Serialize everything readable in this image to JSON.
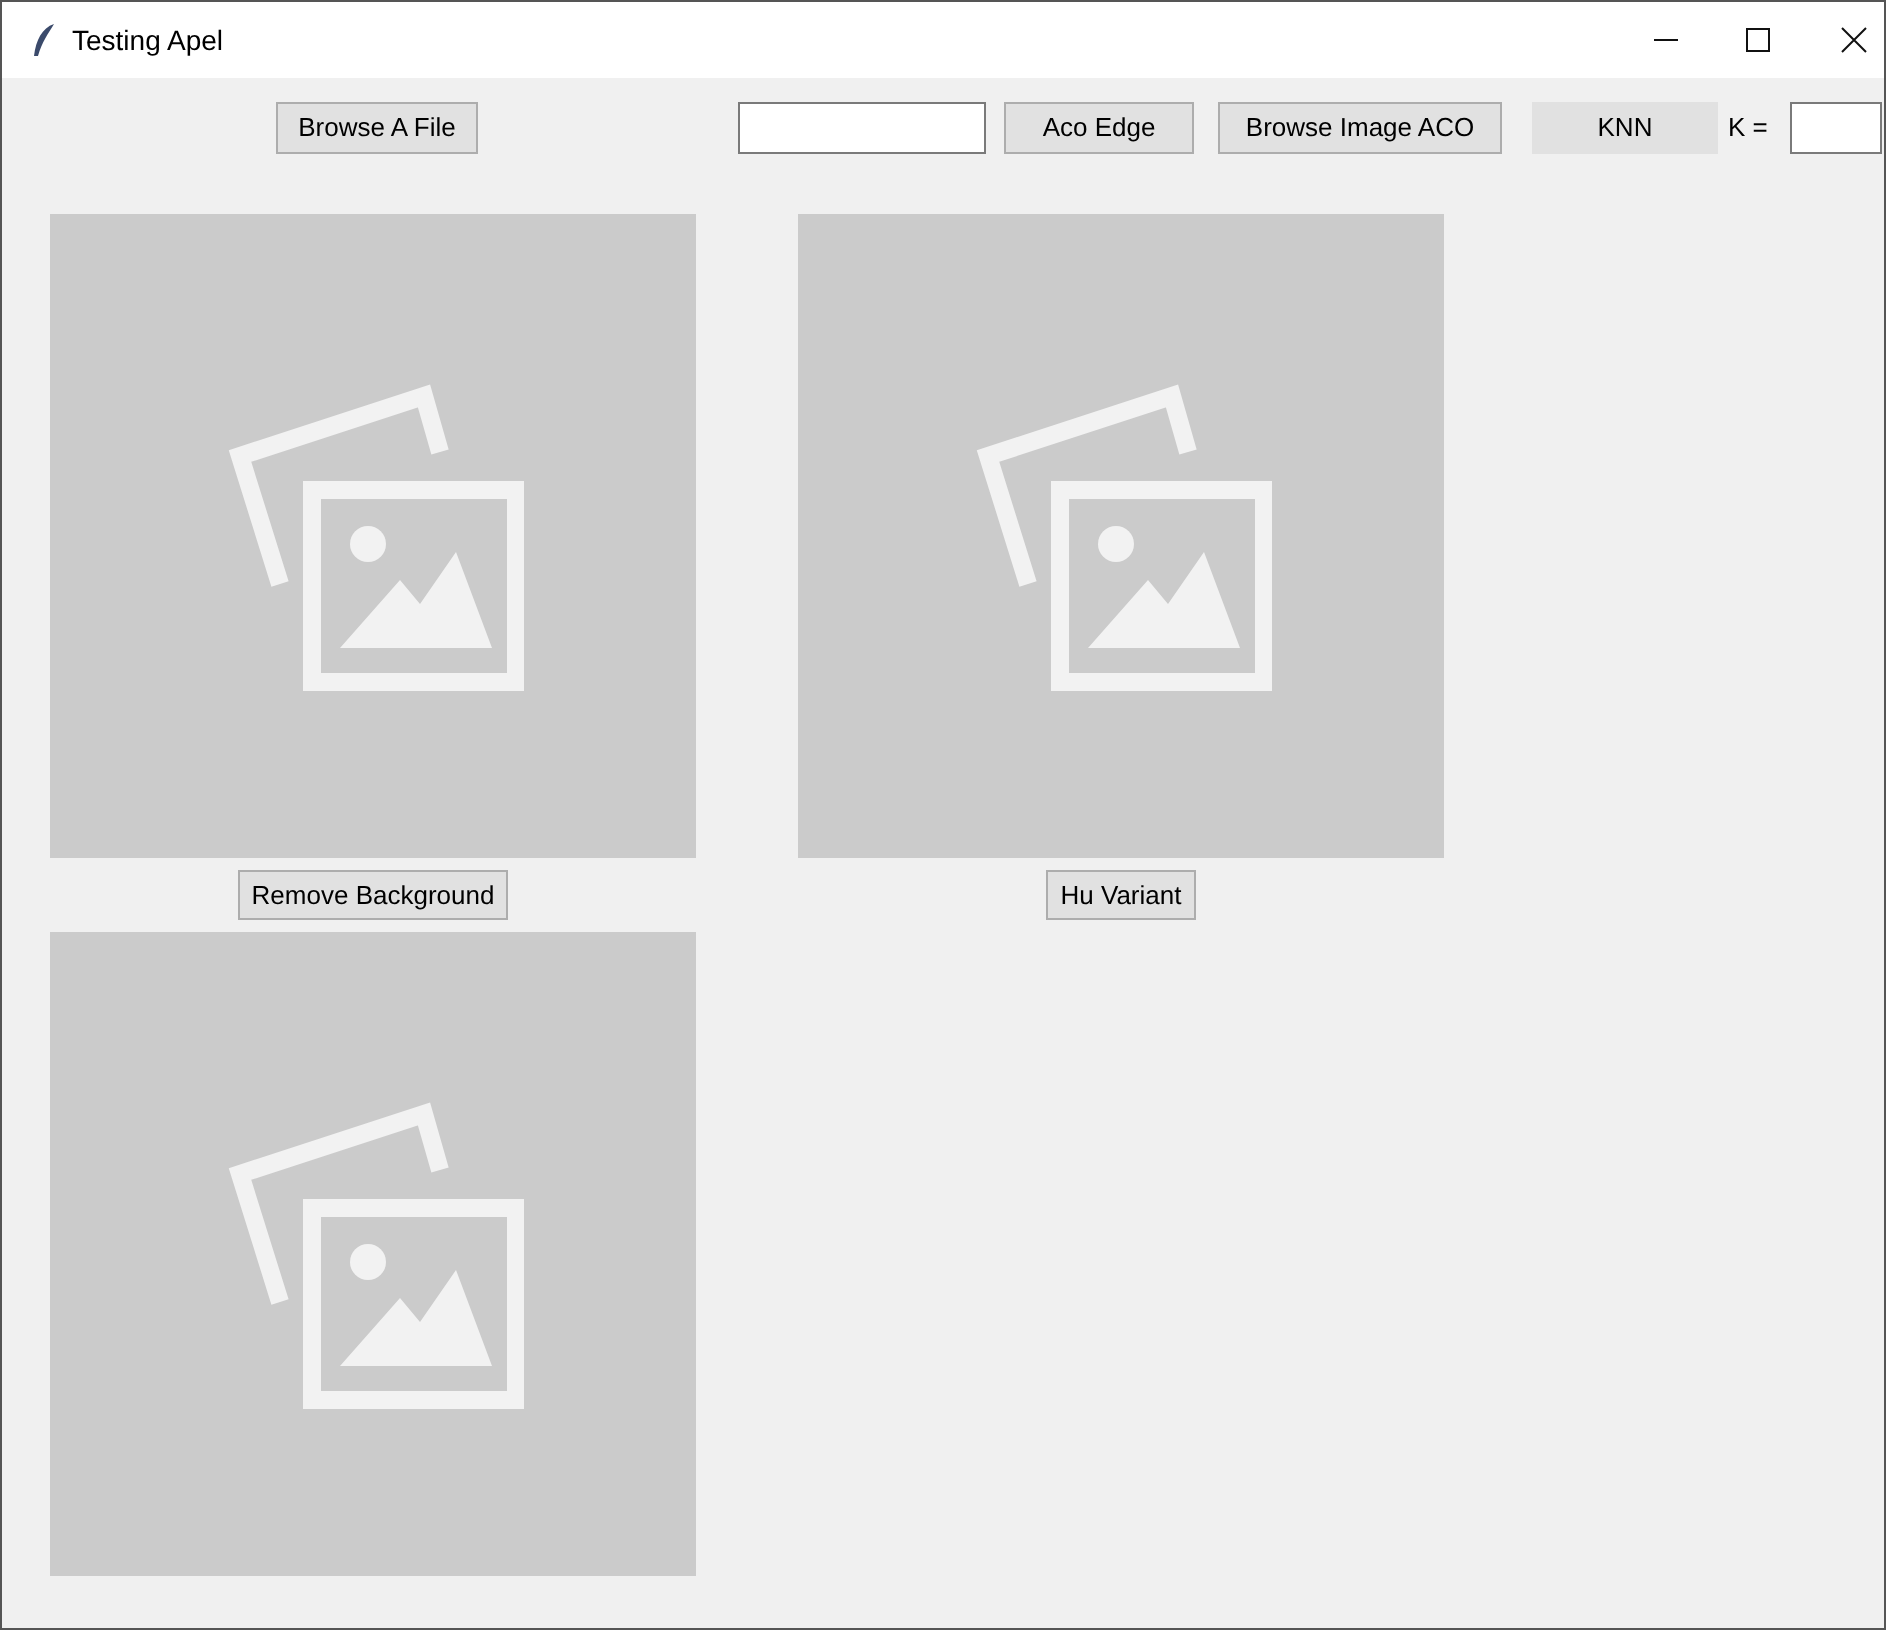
{
  "window": {
    "title": "Testing Apel"
  },
  "toolbar": [
    {
      "kind": "button",
      "label": "Browse A File"
    },
    {
      "kind": "field"
    },
    {
      "kind": "button",
      "label": "Aco Edge"
    },
    {
      "kind": "button",
      "label": "Browse Image ACO"
    },
    {
      "kind": "flat-button",
      "label": "KNN"
    },
    {
      "kind": "label",
      "label": "K ="
    },
    {
      "kind": "field"
    }
  ],
  "panel_buttons": [
    {
      "label": "Remove Background"
    },
    {
      "label": "Hu Variant"
    }
  ]
}
